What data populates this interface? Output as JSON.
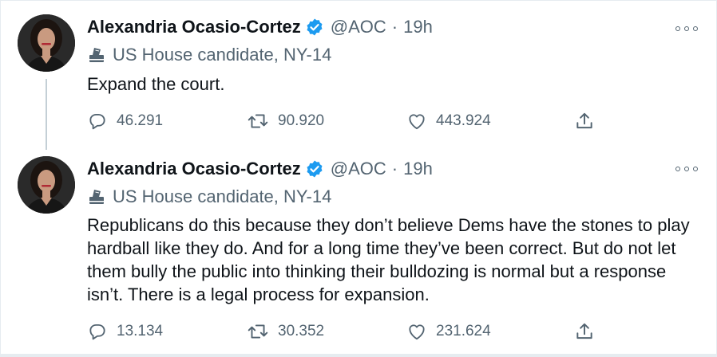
{
  "tweets": [
    {
      "author": {
        "name": "Alexandria Ocasio-Cortez",
        "handle": "@AOC",
        "time": "19h",
        "separator": "·",
        "verified": true
      },
      "label": "US House candidate, NY-14",
      "text": "Expand the court.",
      "stats": {
        "replies": "46.291",
        "retweets": "90.920",
        "likes": "443.924"
      }
    },
    {
      "author": {
        "name": "Alexandria Ocasio-Cortez",
        "handle": "@AOC",
        "time": "19h",
        "separator": "·",
        "verified": true
      },
      "label": "US House candidate, NY-14",
      "text": "Republicans do this because they don’t believe Dems have the stones to play hardball like they do. And for a long time they’ve been correct. But do not let them bully the public into thinking their bulldozing is normal but a response isn’t. There is a legal process for expansion.",
      "stats": {
        "replies": "13.134",
        "retweets": "30.352",
        "likes": "231.624"
      }
    }
  ],
  "icons": {
    "verified": "verified-badge-icon",
    "label": "ballot-box-icon",
    "more": "more-options-icon",
    "reply": "reply-icon",
    "retweet": "retweet-icon",
    "like": "heart-icon",
    "share": "share-icon"
  },
  "colors": {
    "verified": "#1d9bf0",
    "text": "#0f1419",
    "secondary": "#536471",
    "thread_line": "#c4cfd6"
  }
}
